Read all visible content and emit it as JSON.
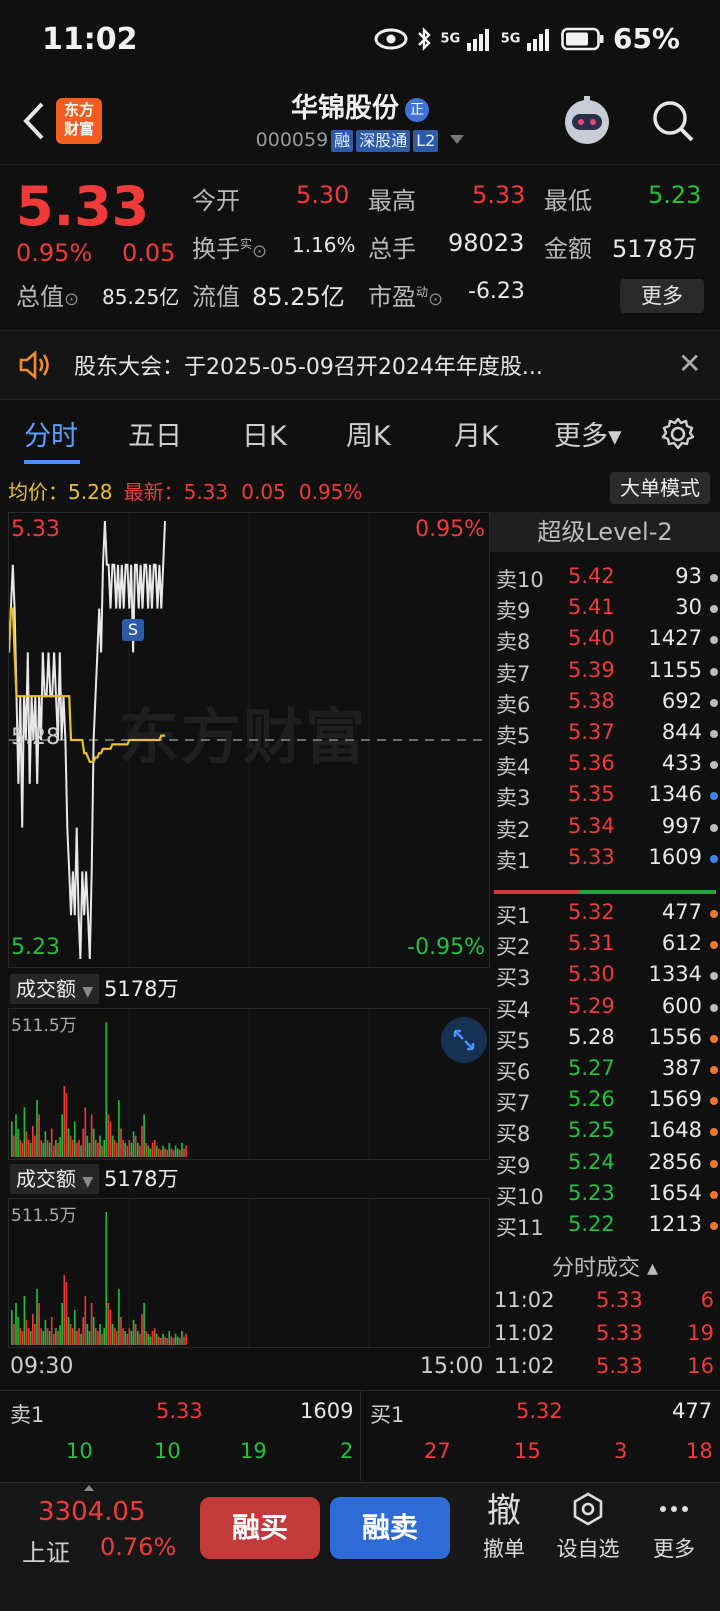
{
  "status_bar": {
    "time": "11:02",
    "battery": "65%",
    "signal1": "5G",
    "signal2": "5G"
  },
  "header": {
    "logo_line1": "东方",
    "logo_line2": "财富",
    "stock_name": "华锦股份",
    "badge": "正",
    "code": "000059",
    "tags": [
      "融",
      "深股通",
      "L2"
    ]
  },
  "quote": {
    "price": "5.33",
    "change_pct": "0.95%",
    "change": "0.05",
    "open_label": "今开",
    "open": "5.30",
    "high_label": "最高",
    "high": "5.33",
    "low_label": "最低",
    "low": "5.23",
    "turnover_label": "换手",
    "turnover_sup": "实",
    "turnover": "1.16%",
    "volume_label": "总手",
    "volume": "98023",
    "amount_label": "金额",
    "amount": "5178万",
    "mktcap_label": "总值",
    "mktcap": "85.25亿",
    "float_label": "流值",
    "float": "85.25亿",
    "pe_label": "市盈",
    "pe_sup": "动",
    "pe": "-6.23",
    "more": "更多"
  },
  "notice": {
    "text": "股东大会：于2025-05-09召开2024年年度股...",
    "close": "✕"
  },
  "tabs": [
    {
      "label": "分时"
    },
    {
      "label": "五日"
    },
    {
      "label": "日K"
    },
    {
      "label": "周K"
    },
    {
      "label": "月K"
    },
    {
      "label": "更多▾"
    }
  ],
  "avg_bar": {
    "avg_label": "均价：",
    "avg": "5.28",
    "latest_label": "最新：",
    "latest": "5.33",
    "latest_chg": "0.05",
    "latest_pct": "0.95%",
    "big_order": "大单模式"
  },
  "chart_labels": {
    "top_price": "5.33",
    "top_pct": "0.95%",
    "mid_price": "5.28",
    "bottom_price": "5.23",
    "bottom_pct": "-0.95%",
    "watermark": "东方财富",
    "marker": "S"
  },
  "chart_data": {
    "type": "line",
    "ylim": [
      5.23,
      5.33
    ],
    "series": [
      {
        "values": [
          5.3,
          5.31,
          5.32,
          5.31,
          5.29,
          5.27,
          5.29,
          5.26,
          5.29,
          5.28,
          5.3,
          5.27,
          5.29,
          5.28,
          5.29,
          5.27,
          5.29,
          5.28,
          5.3,
          5.29,
          5.29,
          5.3,
          5.29,
          5.29,
          5.3,
          5.29,
          5.28,
          5.3,
          5.28,
          5.29,
          5.28,
          5.26,
          5.25,
          5.24,
          5.25,
          5.24,
          5.26,
          5.24,
          5.23,
          5.25,
          5.24,
          5.25,
          5.24,
          5.23,
          5.25,
          5.28,
          5.29,
          5.3,
          5.31,
          5.3,
          5.32,
          5.33,
          5.32,
          5.32,
          5.31,
          5.32,
          5.32,
          5.31,
          5.32,
          5.31,
          5.32,
          5.31,
          5.32,
          5.32,
          5.31,
          5.32,
          5.3,
          5.32,
          5.32,
          5.31,
          5.32,
          5.31,
          5.32,
          5.32,
          5.31,
          5.32,
          5.31,
          5.32,
          5.32,
          5.31,
          5.32,
          5.31,
          5.32,
          5.33
        ]
      },
      {
        "values": [
          5.3,
          5.31,
          5.31,
          5.3,
          5.29,
          5.29,
          5.29,
          5.29,
          5.29,
          5.29,
          5.29,
          5.29,
          5.29,
          5.29,
          5.29,
          5.29,
          5.29,
          5.29,
          5.29,
          5.29,
          5.29,
          5.29,
          5.29,
          5.29,
          5.29,
          5.29,
          5.29,
          5.29,
          5.29,
          5.29,
          5.29,
          5.29,
          5.29,
          5.28,
          5.28,
          5.28,
          5.28,
          5.28,
          5.28,
          5.28,
          5.277,
          5.277,
          5.276,
          5.275,
          5.275,
          5.275,
          5.276,
          5.276,
          5.277,
          5.277,
          5.278,
          5.278,
          5.278,
          5.278,
          5.278,
          5.279,
          5.279,
          5.279,
          5.279,
          5.279,
          5.279,
          5.279,
          5.279,
          5.279,
          5.28,
          5.28,
          5.28,
          5.28,
          5.28,
          5.28,
          5.28,
          5.28,
          5.28,
          5.28,
          5.28,
          5.28,
          5.28,
          5.28,
          5.28,
          5.28,
          5.28,
          5.281,
          5.281,
          5.281
        ]
      }
    ],
    "volume_top_label": "511.5万"
  },
  "volume_panels": [
    {
      "label": "成交额",
      "value": "5178万",
      "max": "511.5万"
    },
    {
      "label": "成交额",
      "value": "5178万",
      "max": "511.5万"
    }
  ],
  "time_axis": {
    "start": "09:30",
    "end": "15:00"
  },
  "order_book": {
    "title": "超级Level-2",
    "asks": [
      {
        "label": "卖10",
        "price": "5.42",
        "vol": "93",
        "dot": "#bbbbbb"
      },
      {
        "label": "卖9",
        "price": "5.41",
        "vol": "30",
        "dot": "#bbbbbb"
      },
      {
        "label": "卖8",
        "price": "5.40",
        "vol": "1427",
        "dot": "#bbbbbb"
      },
      {
        "label": "卖7",
        "price": "5.39",
        "vol": "1155",
        "dot": "#bbbbbb"
      },
      {
        "label": "卖6",
        "price": "5.38",
        "vol": "692",
        "dot": "#bbbbbb"
      },
      {
        "label": "卖5",
        "price": "5.37",
        "vol": "844",
        "dot": "#bbbbbb"
      },
      {
        "label": "卖4",
        "price": "5.36",
        "vol": "433",
        "dot": "#bbbbbb"
      },
      {
        "label": "卖3",
        "price": "5.35",
        "vol": "1346",
        "dot": "#3d86e8"
      },
      {
        "label": "卖2",
        "price": "5.34",
        "vol": "997",
        "dot": "#bbbbbb"
      },
      {
        "label": "卖1",
        "price": "5.33",
        "vol": "1609",
        "dot": "#3d86e8"
      }
    ],
    "bids": [
      {
        "label": "买1",
        "price": "5.32",
        "vol": "477",
        "dot": "#f0782e",
        "color": "red"
      },
      {
        "label": "买2",
        "price": "5.31",
        "vol": "612",
        "dot": "#f0782e",
        "color": "red"
      },
      {
        "label": "买3",
        "price": "5.30",
        "vol": "1334",
        "dot": "#bbbbbb",
        "color": "red"
      },
      {
        "label": "买4",
        "price": "5.29",
        "vol": "600",
        "dot": "#bbbbbb",
        "color": "red"
      },
      {
        "label": "买5",
        "price": "5.28",
        "vol": "1556",
        "dot": "#f0782e",
        "color": "white"
      },
      {
        "label": "买6",
        "price": "5.27",
        "vol": "387",
        "dot": "#f0782e",
        "color": "green"
      },
      {
        "label": "买7",
        "price": "5.26",
        "vol": "1569",
        "dot": "#f0782e",
        "color": "green"
      },
      {
        "label": "买8",
        "price": "5.25",
        "vol": "1648",
        "dot": "#f0782e",
        "color": "green"
      },
      {
        "label": "买9",
        "price": "5.24",
        "vol": "2856",
        "dot": "#f0782e",
        "color": "green"
      },
      {
        "label": "买10",
        "price": "5.23",
        "vol": "1654",
        "dot": "#f0782e",
        "color": "green"
      },
      {
        "label": "买11",
        "price": "5.22",
        "vol": "1213",
        "dot": "#f0782e",
        "color": "green"
      }
    ],
    "trades_title": "分时成交 ▴",
    "trades": [
      {
        "time": "11:02",
        "price": "5.33",
        "vol": "6"
      },
      {
        "time": "11:02",
        "price": "5.33",
        "vol": "19"
      },
      {
        "time": "11:02",
        "price": "5.33",
        "vol": "16"
      }
    ]
  },
  "best": {
    "sell_label": "卖1",
    "sell_price": "5.33",
    "sell_vol": "1609",
    "buy_label": "买1",
    "buy_price": "5.32",
    "buy_vol": "477",
    "sell_queue": [
      "10",
      "10",
      "19",
      "2"
    ],
    "buy_queue": [
      "27",
      "15",
      "3",
      "18"
    ]
  },
  "footer": {
    "index_value": "3304.05",
    "index_name": "上证",
    "index_chg": "0.76%",
    "buy_btn": "融买",
    "sell_btn": "融卖",
    "cancel_icon": "撤",
    "cancel_label": "撤单",
    "watch_label": "设自选",
    "more_label": "更多"
  },
  "colors": {
    "up": "#f03a3a",
    "down": "#22c03c",
    "avg": "#e8c12c",
    "accent": "#4a8fff"
  }
}
